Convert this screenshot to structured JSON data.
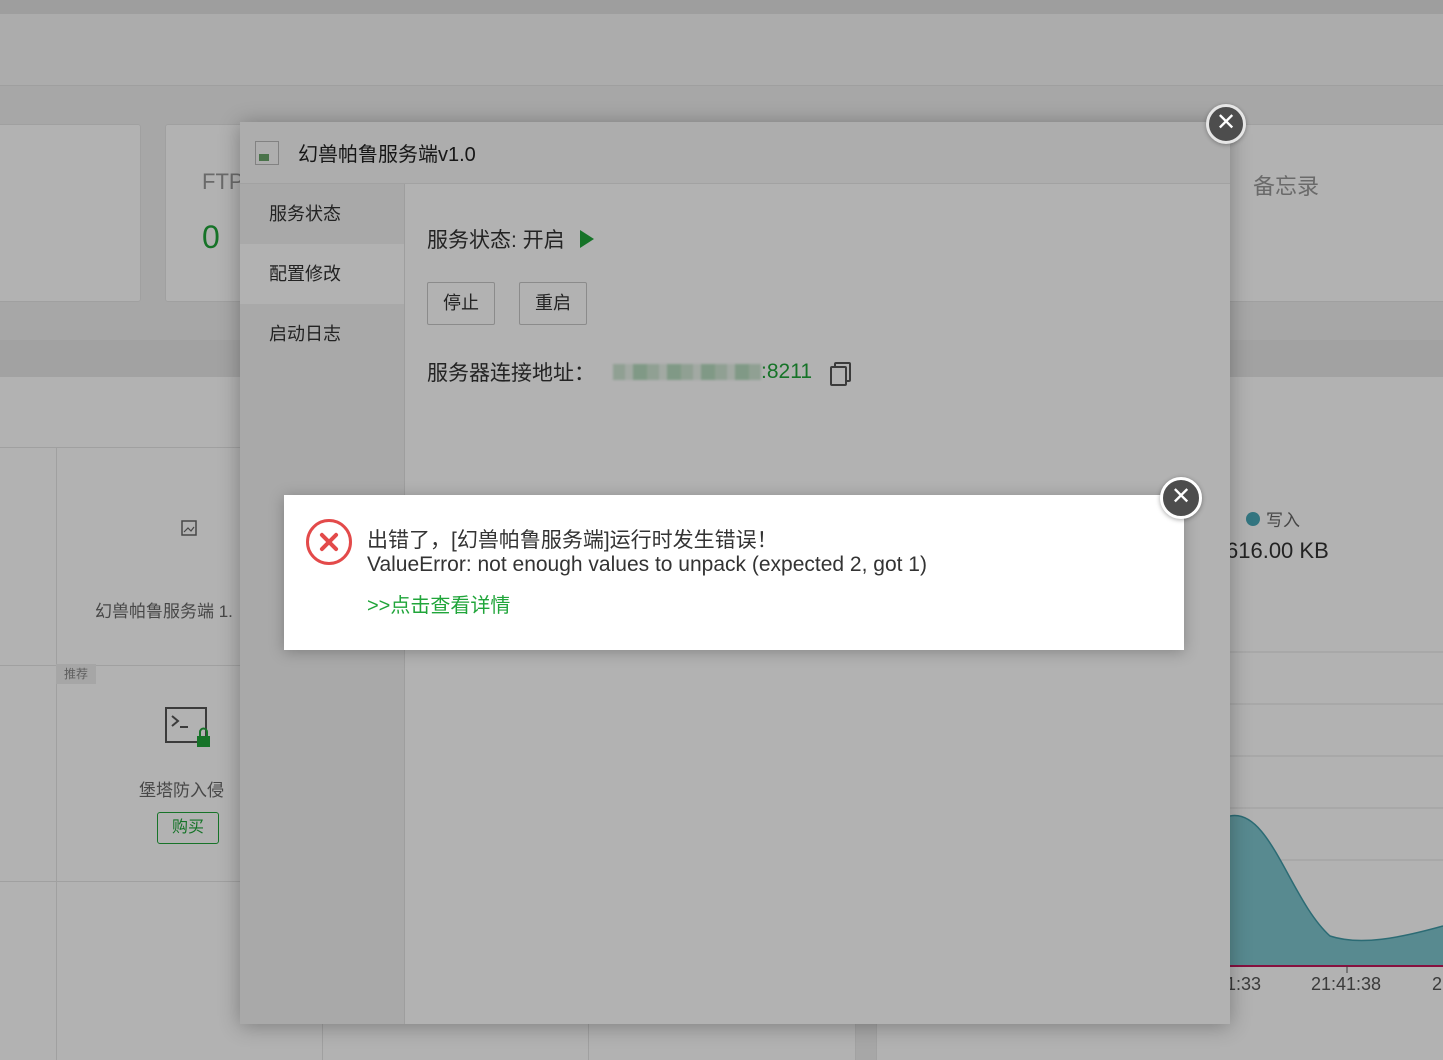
{
  "background": {
    "cards": [
      {
        "label": "FTP",
        "value": "0"
      },
      {
        "label": "备忘录"
      }
    ],
    "plugins": [
      {
        "name": "幻兽帕鲁服务端 1."
      },
      {
        "name": "堡塔防入侵",
        "tag": "推荐",
        "action": "购买"
      }
    ],
    "chart": {
      "legend": "写入",
      "value": "616.00 KB",
      "time_ticks": [
        "1:33",
        "21:41:38",
        "2"
      ]
    }
  },
  "dialog": {
    "title": "幻兽帕鲁服务端v1.0",
    "close_symbol": "✕",
    "menu": [
      "服务状态",
      "配置修改",
      "启动日志"
    ],
    "status_label": "服务状态: 开启",
    "buttons": {
      "stop": "停止",
      "restart": "重启"
    },
    "address_label": "服务器连接地址：",
    "address_port": ":8211"
  },
  "error": {
    "line1": "出错了，[幻兽帕鲁服务端]运行时发生错误！",
    "line2": "ValueError: not enough values to unpack (expected 2, got 1)",
    "link": ">>点击查看详情",
    "close_symbol": "✕"
  }
}
